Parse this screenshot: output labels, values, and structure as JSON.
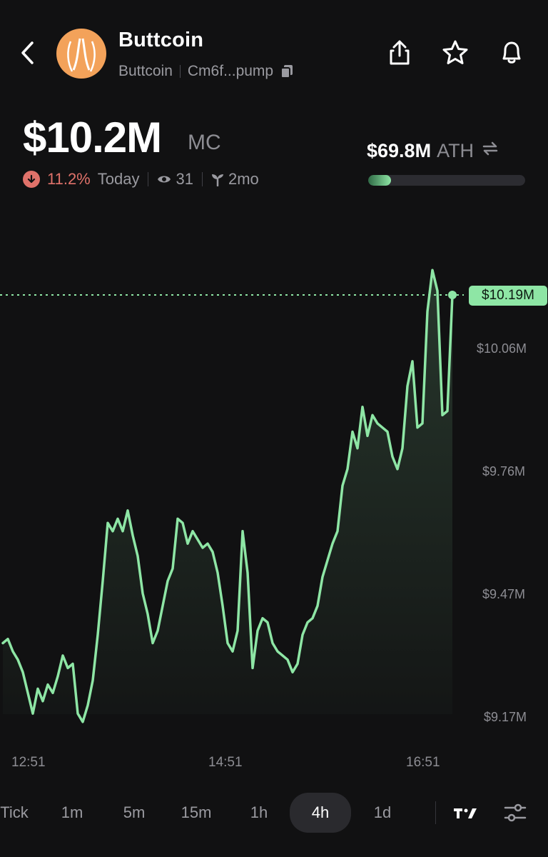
{
  "header": {
    "title": "Buttcoin",
    "name": "Buttcoin",
    "address": "Cm6f...pump",
    "icons": [
      "chevron-left-icon",
      "share-icon",
      "star-icon",
      "bell-icon",
      "copy-icon"
    ]
  },
  "market": {
    "mc_value": "$10.2M",
    "mc_unit": "MC",
    "change_pct": "11.2%",
    "change_period": "Today",
    "views": "31",
    "age": "2mo",
    "ath_value": "$69.8M",
    "ath_label": "ATH",
    "ath_progress": 0.146
  },
  "colors": {
    "accent": "#8ee6a5",
    "negative": "#e0726a",
    "background": "#111112"
  },
  "chart_data": {
    "type": "line",
    "current_price_label": "$10.19M",
    "y_ticks": [
      "$10.06M",
      "$9.76M",
      "$9.47M",
      "$9.17M"
    ],
    "x_ticks": [
      "12:51",
      "14:51",
      "16:51"
    ],
    "ylim": [
      9.17,
      10.19
    ],
    "series": [
      {
        "values": [
          9.35,
          9.36,
          9.33,
          9.31,
          9.28,
          9.23,
          9.18,
          9.24,
          9.21,
          9.25,
          9.23,
          9.27,
          9.32,
          9.29,
          9.3,
          9.18,
          9.16,
          9.2,
          9.26,
          9.37,
          9.5,
          9.64,
          9.62,
          9.65,
          9.62,
          9.67,
          9.61,
          9.56,
          9.47,
          9.42,
          9.35,
          9.38,
          9.44,
          9.5,
          9.53,
          9.65,
          9.64,
          9.59,
          9.62,
          9.6,
          9.58,
          9.59,
          9.57,
          9.52,
          9.44,
          9.35,
          9.33,
          9.38,
          9.62,
          9.52,
          9.29,
          9.38,
          9.41,
          9.4,
          9.35,
          9.33,
          9.32,
          9.31,
          9.28,
          9.3,
          9.37,
          9.4,
          9.41,
          9.44,
          9.51,
          9.55,
          9.59,
          9.62,
          9.73,
          9.77,
          9.86,
          9.82,
          9.92,
          9.85,
          9.9,
          9.88,
          9.87,
          9.86,
          9.8,
          9.77,
          9.82,
          9.97,
          10.03,
          9.87,
          9.88,
          10.15,
          10.25,
          10.2,
          9.9,
          9.91,
          10.19
        ]
      }
    ]
  },
  "timeframes": {
    "items": [
      "Tick",
      "1m",
      "5m",
      "15m",
      "1h",
      "4h",
      "1d"
    ],
    "active": "4h"
  },
  "toolbar": {
    "icons": [
      "tradingview-icon",
      "settings-sliders-icon"
    ]
  }
}
